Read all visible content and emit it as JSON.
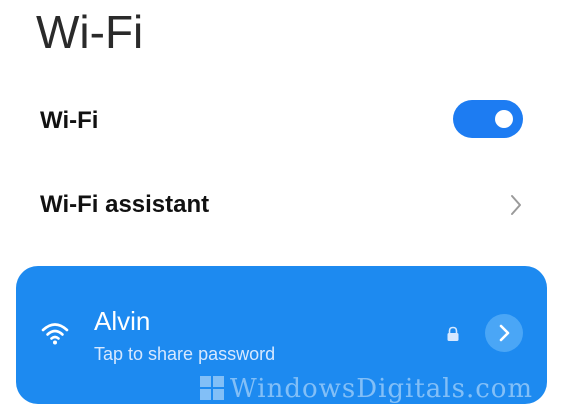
{
  "page": {
    "title": "Wi-Fi"
  },
  "wifi_row": {
    "label": "Wi-Fi",
    "toggle_on": true
  },
  "assistant_row": {
    "label": "Wi-Fi assistant"
  },
  "network": {
    "name": "Alvin",
    "subtitle": "Tap to share password",
    "secured": true
  },
  "watermark": {
    "text": "WindowsDigitals.com"
  },
  "icons": {
    "wifi": "wifi-icon",
    "lock": "lock-icon",
    "chevron": "chevron-right-icon",
    "details": "details-arrow-icon"
  },
  "colors": {
    "accent": "#1d7cf2",
    "card": "#1d8af0"
  }
}
